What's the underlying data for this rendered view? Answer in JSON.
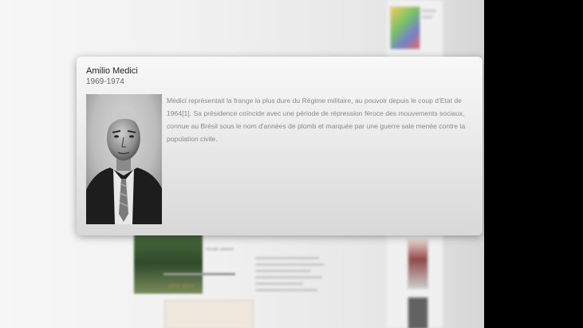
{
  "popup": {
    "title": "Amilio Medici",
    "years": "1969-1974",
    "description": "Médici représentait la frange la plus dure du Régime militaire, au pouvoir depuis le coup d'Etat de 1964[1]. Sa présidence coïncide avec une période de répression féroce des mouvements sociaux, connue au Brésil sous le nom d'années de plomb et marquée par une guerre sale menée contre la population civile.",
    "image": "portrait-photo"
  },
  "background": {
    "caption": "Route sillière",
    "heading": "1973 1974"
  },
  "colors": {
    "card_top": "#f8f8f8",
    "card_bottom": "#d8d8d8",
    "text_muted": "#8a8a8a",
    "side_bar": "#000000"
  }
}
